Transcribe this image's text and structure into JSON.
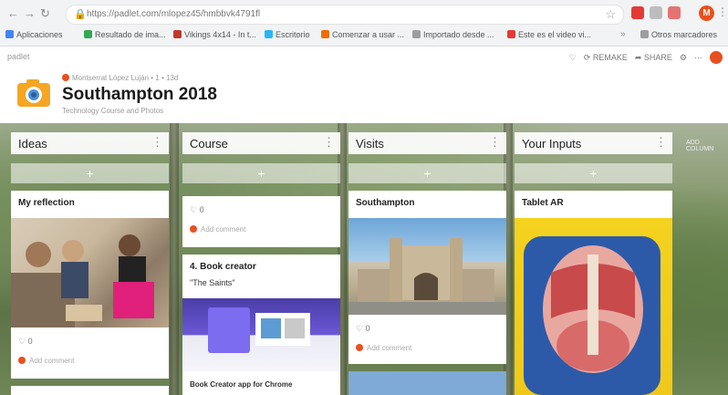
{
  "browser": {
    "url": "https://padlet.com/mlopez45/hmbbvk4791fl",
    "bookmarks": [
      "Aplicaciones",
      "Resultado de ima...",
      "Vikings 4x14 - In t...",
      "Escritorio",
      "Comenzar a usar ...",
      "Importado desde ...",
      "Este es el video vi...",
      "Otros marcadores"
    ],
    "profile_initial": "M"
  },
  "padlet": {
    "brand": "padlet",
    "author": "Montserrat López Luján • 1 • 13d",
    "title": "Southampton 2018",
    "subtitle": "Technology Course and Photos",
    "actions": [
      "REMAKE",
      "SHARE"
    ]
  },
  "columns": [
    {
      "name": "Ideas",
      "cards": [
        {
          "title": "My reflection",
          "likes": "0",
          "comment": "Add comment"
        }
      ]
    },
    {
      "name": "Course",
      "cards": [
        {
          "likes": "0",
          "comment": "Add comment"
        },
        {
          "title": "4. Book creator",
          "body": "\"The Saints\"",
          "caption": "Book Creator app for Chrome"
        }
      ]
    },
    {
      "name": "Visits",
      "cards": [
        {
          "title": "Southampton",
          "likes": "0",
          "comment": "Add comment"
        }
      ]
    },
    {
      "name": "Your Inputs",
      "cards": [
        {
          "title": "Tablet AR"
        }
      ]
    }
  ],
  "add_column": "ADD COLUMN",
  "colors": {
    "accent": "#e8501f",
    "camera": "#f5a623"
  }
}
